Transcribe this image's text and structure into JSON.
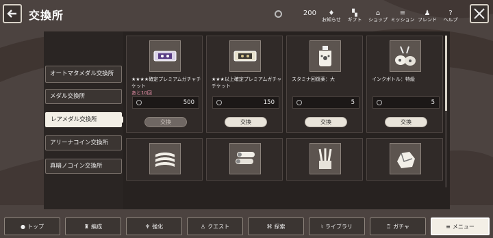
{
  "header": {
    "title": "交換所",
    "currency_value": "200",
    "icons": [
      {
        "name": "お知らせ",
        "glyph": "♦"
      },
      {
        "name": "ギフト",
        "glyph": "▚"
      },
      {
        "name": "ショップ",
        "glyph": "⌂"
      },
      {
        "name": "ミッション",
        "glyph": "≡"
      },
      {
        "name": "フレンド",
        "glyph": "♟"
      },
      {
        "name": "ヘルプ",
        "glyph": "?"
      }
    ]
  },
  "sidebar": {
    "items": [
      {
        "label": "オートマタメダル交換所"
      },
      {
        "label": "メダル交換所"
      },
      {
        "label": "レアメダル交換所"
      },
      {
        "label": "アリーナコイン交換所"
      },
      {
        "label": "真暗ノコイン交換所"
      }
    ],
    "active_index": 2
  },
  "shop": {
    "items": [
      {
        "name": "★★★★確定プレミアムガチャチケット",
        "limit": "あと10回",
        "price": "500",
        "button": "交換",
        "icon": "ticket-icon",
        "enabled": false
      },
      {
        "name": "★★★以上確定プレミアムガチャチケット",
        "limit": "",
        "price": "150",
        "button": "交換",
        "icon": "ticket-icon",
        "enabled": true
      },
      {
        "name": "スタミナ回復薬：大",
        "limit": "",
        "price": "5",
        "button": "交換",
        "icon": "stamina-potion-icon",
        "enabled": true
      },
      {
        "name": "インクボトル：特級",
        "limit": "",
        "price": "5",
        "button": "交換",
        "icon": "ink-bottle-icon",
        "enabled": true
      },
      {
        "icon": "cloth-icon"
      },
      {
        "icon": "wood-logs-icon"
      },
      {
        "icon": "brush-icon"
      },
      {
        "icon": "ore-icon"
      }
    ]
  },
  "nav": {
    "items": [
      {
        "label": "トップ",
        "glyph": "●"
      },
      {
        "label": "編成",
        "glyph": "♜"
      },
      {
        "label": "強化",
        "glyph": "♆"
      },
      {
        "label": "クエスト",
        "glyph": "♙"
      },
      {
        "label": "探索",
        "glyph": "⌘"
      },
      {
        "label": "ライブラリ",
        "glyph": "♮"
      },
      {
        "label": "ガチャ",
        "glyph": "♖"
      },
      {
        "label": "メニュー",
        "glyph": "≡"
      }
    ],
    "active_index": 7
  },
  "colors": {
    "accent_pink": "#e58fa7",
    "panel_light": "#f3efe6"
  }
}
